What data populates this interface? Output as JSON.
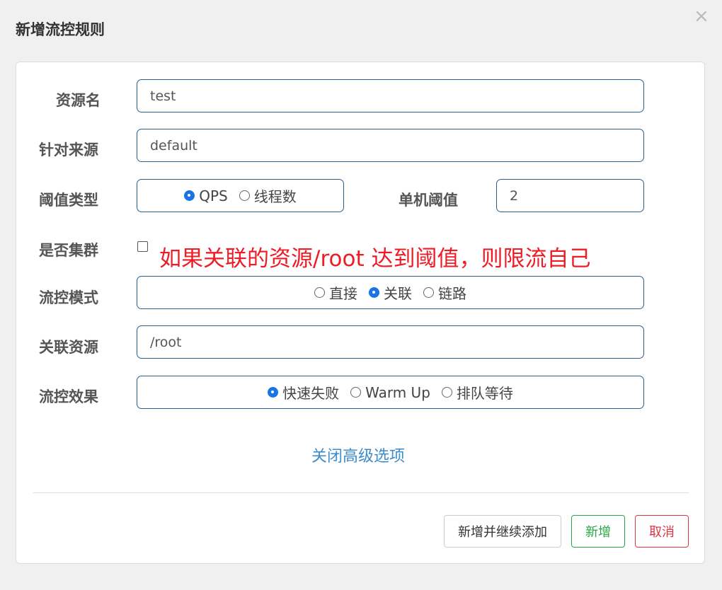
{
  "dialog": {
    "title": "新增流控规则",
    "close_label": "×"
  },
  "form": {
    "resource_name": {
      "label": "资源名",
      "value": "test"
    },
    "limit_app": {
      "label": "针对来源",
      "value": "default"
    },
    "threshold_type": {
      "label": "阈值类型",
      "options": [
        {
          "label": "QPS",
          "selected": true
        },
        {
          "label": "线程数",
          "selected": false
        }
      ]
    },
    "single_threshold": {
      "label": "单机阈值",
      "value": "2"
    },
    "cluster": {
      "label": "是否集群",
      "checked": false
    },
    "annotation": "如果关联的资源/root 达到阈值，则限流自己",
    "strategy": {
      "label": "流控模式",
      "options": [
        {
          "label": "直接",
          "selected": false
        },
        {
          "label": "关联",
          "selected": true
        },
        {
          "label": "链路",
          "selected": false
        }
      ]
    },
    "ref_resource": {
      "label": "关联资源",
      "value": "/root"
    },
    "control_behavior": {
      "label": "流控效果",
      "options": [
        {
          "label": "快速失败",
          "selected": true
        },
        {
          "label": "Warm Up",
          "selected": false
        },
        {
          "label": "排队等待",
          "selected": false
        }
      ]
    },
    "advanced_toggle": "关闭高级选项"
  },
  "footer": {
    "add_continue_label": "新增并继续添加",
    "add_label": "新增",
    "cancel_label": "取消",
    "colors": {
      "add": "#28a745",
      "cancel": "#dc3545"
    }
  }
}
